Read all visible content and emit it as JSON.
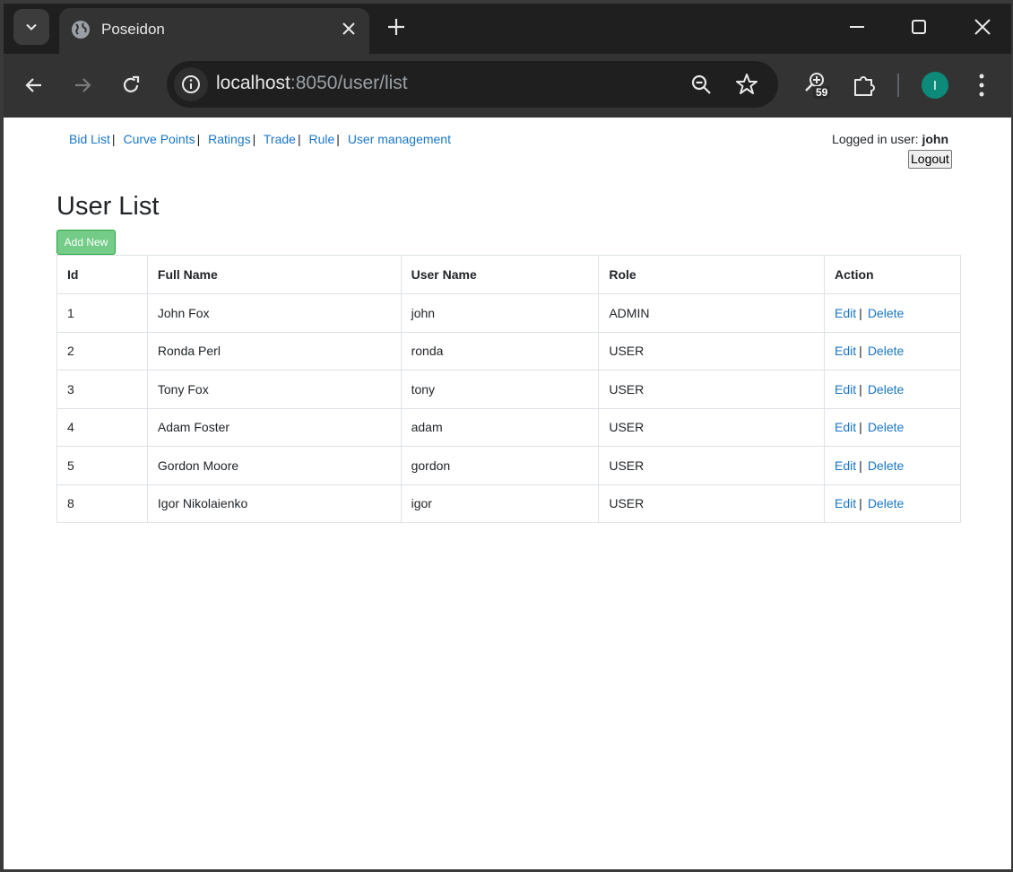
{
  "browser": {
    "tab_title": "Poseidon",
    "url_host": "localhost",
    "url_rest": ":8050/user/list",
    "extension_count": "59",
    "profile_initial": "I"
  },
  "nav": {
    "links": [
      "Bid List",
      "Curve Points",
      "Ratings",
      "Trade",
      "Rule",
      "User management"
    ],
    "separator": "|"
  },
  "session": {
    "logged_in_label": "Logged in user:",
    "username": "john",
    "logout_label": "Logout"
  },
  "page": {
    "title": "User List",
    "add_label": "Add New"
  },
  "table": {
    "headers": [
      "Id",
      "Full Name",
      "User Name",
      "Role",
      "Action"
    ],
    "rows": [
      {
        "id": "1",
        "full_name": "John Fox",
        "username": "john",
        "role": "ADMIN"
      },
      {
        "id": "2",
        "full_name": "Ronda Perl",
        "username": "ronda",
        "role": "USER"
      },
      {
        "id": "3",
        "full_name": "Tony Fox",
        "username": "tony",
        "role": "USER"
      },
      {
        "id": "4",
        "full_name": "Adam Foster",
        "username": "adam",
        "role": "USER"
      },
      {
        "id": "5",
        "full_name": "Gordon Moore",
        "username": "gordon",
        "role": "USER"
      },
      {
        "id": "8",
        "full_name": "Igor Nikolaienko",
        "username": "igor",
        "role": "USER"
      }
    ],
    "edit_label": "Edit",
    "delete_label": "Delete",
    "action_separator": "|"
  },
  "colors": {
    "link": "#1976c8",
    "add_button": "#74cc88",
    "avatar": "#0d8a7a"
  }
}
